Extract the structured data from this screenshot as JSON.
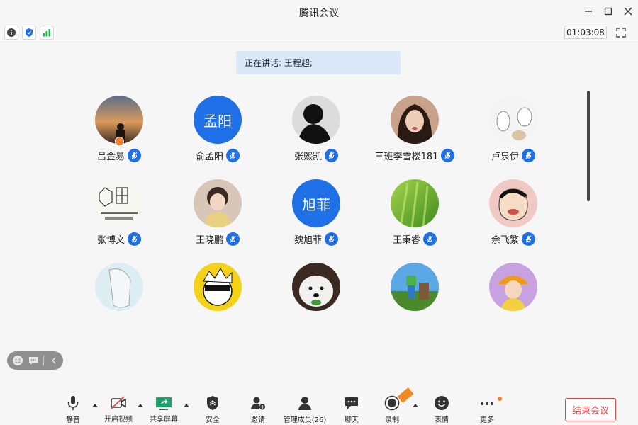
{
  "window": {
    "title": "腾讯会议"
  },
  "infobar": {
    "timer": "01:03:08"
  },
  "speaking": {
    "text": "正在讲话: 王程超;"
  },
  "avatar_text": {
    "yu": "孟阳",
    "wei": "旭菲"
  },
  "participants": [
    {
      "name": "吕金易"
    },
    {
      "name": "俞孟阳"
    },
    {
      "name": "张熙凯"
    },
    {
      "name": "三班李雪楼181"
    },
    {
      "name": "卢泉伊"
    },
    {
      "name": "张博文"
    },
    {
      "name": "王晓鹏"
    },
    {
      "name": "魏旭菲"
    },
    {
      "name": "王秉睿"
    },
    {
      "name": "余飞繁"
    }
  ],
  "toolbar": {
    "mute": "静音",
    "video": "开启视频",
    "share": "共享屏幕",
    "security": "安全",
    "invite": "邀请",
    "members": "管理成员(26)",
    "chat": "聊天",
    "record": "录制",
    "emoji": "表情",
    "more": "更多",
    "end": "结束会议"
  },
  "colors": {
    "accent": "#1f6fe6",
    "end": "#e14545",
    "banner": "#dbe8fa"
  }
}
